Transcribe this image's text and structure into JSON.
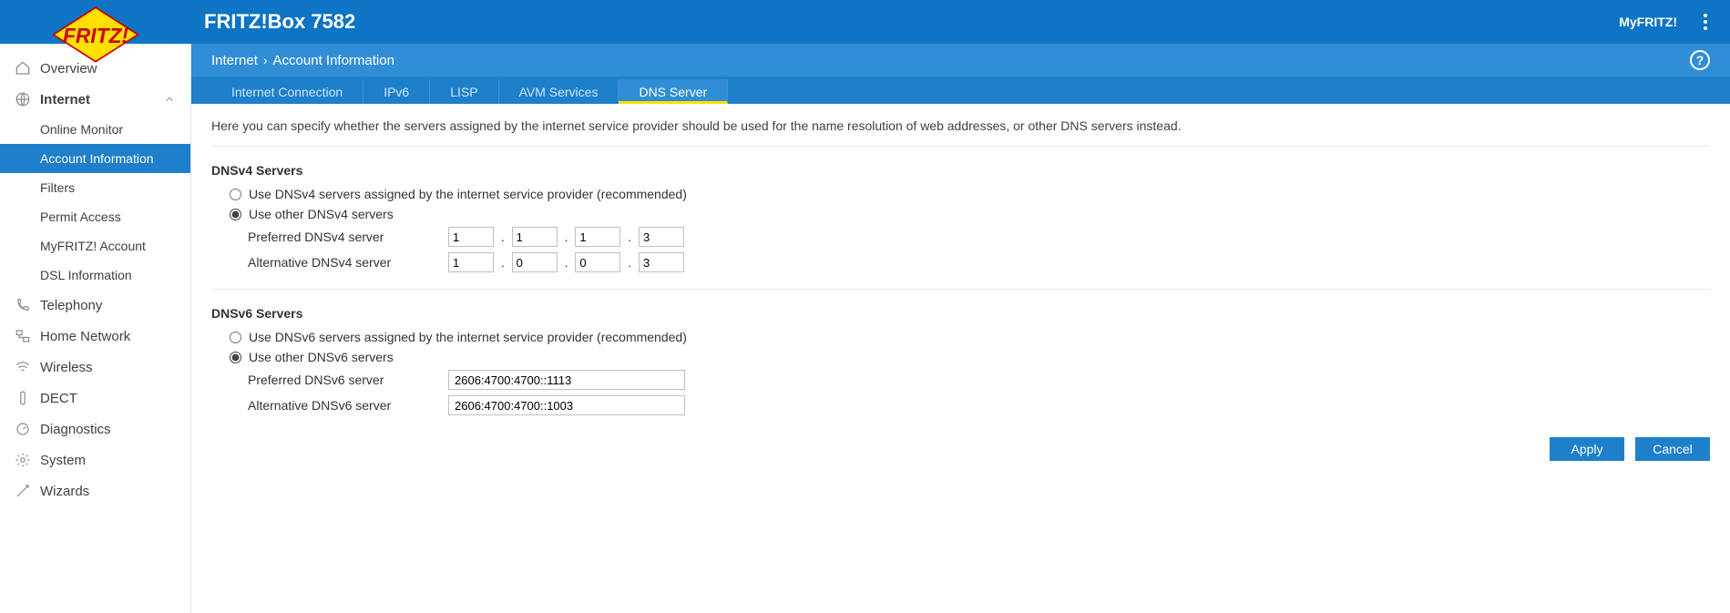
{
  "header": {
    "title": "FRITZ!Box 7582",
    "myfritz": "MyFRITZ!"
  },
  "breadcrumb": {
    "a": "Internet",
    "b": "Account Information"
  },
  "tabs": [
    {
      "label": "Internet Connection"
    },
    {
      "label": "IPv6"
    },
    {
      "label": "LISP"
    },
    {
      "label": "AVM Services"
    },
    {
      "label": "DNS Server"
    }
  ],
  "sidebar": {
    "overview": "Overview",
    "internet": "Internet",
    "sub": {
      "online_monitor": "Online Monitor",
      "account_info": "Account Information",
      "filters": "Filters",
      "permit_access": "Permit Access",
      "myfritz_account": "MyFRITZ! Account",
      "dsl_info": "DSL Information"
    },
    "telephony": "Telephony",
    "home_network": "Home Network",
    "wireless": "Wireless",
    "dect": "DECT",
    "diagnostics": "Diagnostics",
    "system": "System",
    "wizards": "Wizards"
  },
  "page": {
    "description": "Here you can specify whether the servers assigned by the internet service provider should be used for the name resolution of web addresses, or other DNS servers instead.",
    "v4": {
      "title": "DNSv4 Servers",
      "opt_isp": "Use DNSv4 servers assigned by the internet service provider (recommended)",
      "opt_other": "Use other DNSv4 servers",
      "pref_label": "Preferred DNSv4 server",
      "alt_label": "Alternative DNSv4 server",
      "pref": [
        "1",
        "1",
        "1",
        "3"
      ],
      "alt": [
        "1",
        "0",
        "0",
        "3"
      ]
    },
    "v6": {
      "title": "DNSv6 Servers",
      "opt_isp": "Use DNSv6 servers assigned by the internet service provider (recommended)",
      "opt_other": "Use other DNSv6 servers",
      "pref_label": "Preferred DNSv6 server",
      "alt_label": "Alternative DNSv6 server",
      "pref": "2606:4700:4700::1113",
      "alt": "2606:4700:4700::1003"
    },
    "apply": "Apply",
    "cancel": "Cancel"
  }
}
